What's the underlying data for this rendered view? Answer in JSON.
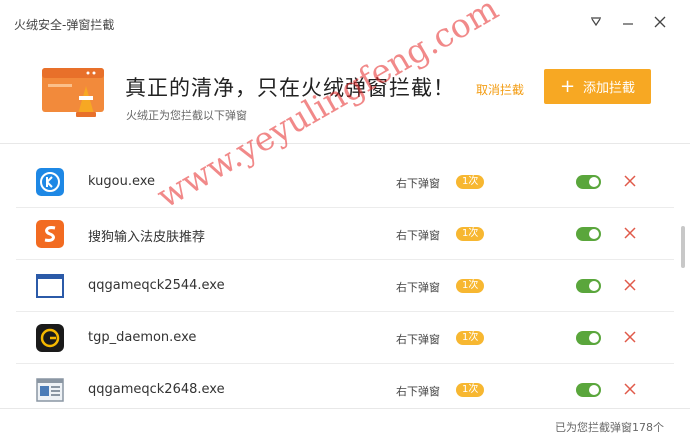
{
  "window": {
    "title": "火绒安全-弹窗拦截",
    "controls": [
      "dropdown-icon",
      "minimize-icon",
      "close-icon"
    ]
  },
  "header": {
    "headline": "真正的清净，只在火绒弹窗拦截！",
    "subline": "火绒正为您拦截以下弹窗",
    "cancel_label": "取消拦截",
    "add_label": "添加拦截",
    "add_icon": "plus-icon",
    "accent_color": "#f7a823"
  },
  "items": [
    {
      "name": "kugou.exe",
      "position": "右下弹窗",
      "count": "1次",
      "icon": "kugou-icon",
      "enabled": true
    },
    {
      "name": "搜狗输入法皮肤推荐",
      "position": "右下弹窗",
      "count": "1次",
      "icon": "sogou-icon",
      "enabled": true
    },
    {
      "name": "qqgameqck2544.exe",
      "position": "右下弹窗",
      "count": "1次",
      "icon": "window-icon",
      "enabled": true
    },
    {
      "name": "tgp_daemon.exe",
      "position": "右下弹窗",
      "count": "1次",
      "icon": "tgp-icon",
      "enabled": true
    },
    {
      "name": "qqgameqck2648.exe",
      "position": "右下弹窗",
      "count": "1次",
      "icon": "document-window-icon",
      "enabled": true
    }
  ],
  "footer": {
    "summary": "已为您拦截弹窗178个"
  },
  "watermark": "www.yeyulingfeng.com",
  "colors": {
    "toggle_on": "#5aa63c",
    "delete": "#e05a4a",
    "badge": "#f7b731"
  }
}
